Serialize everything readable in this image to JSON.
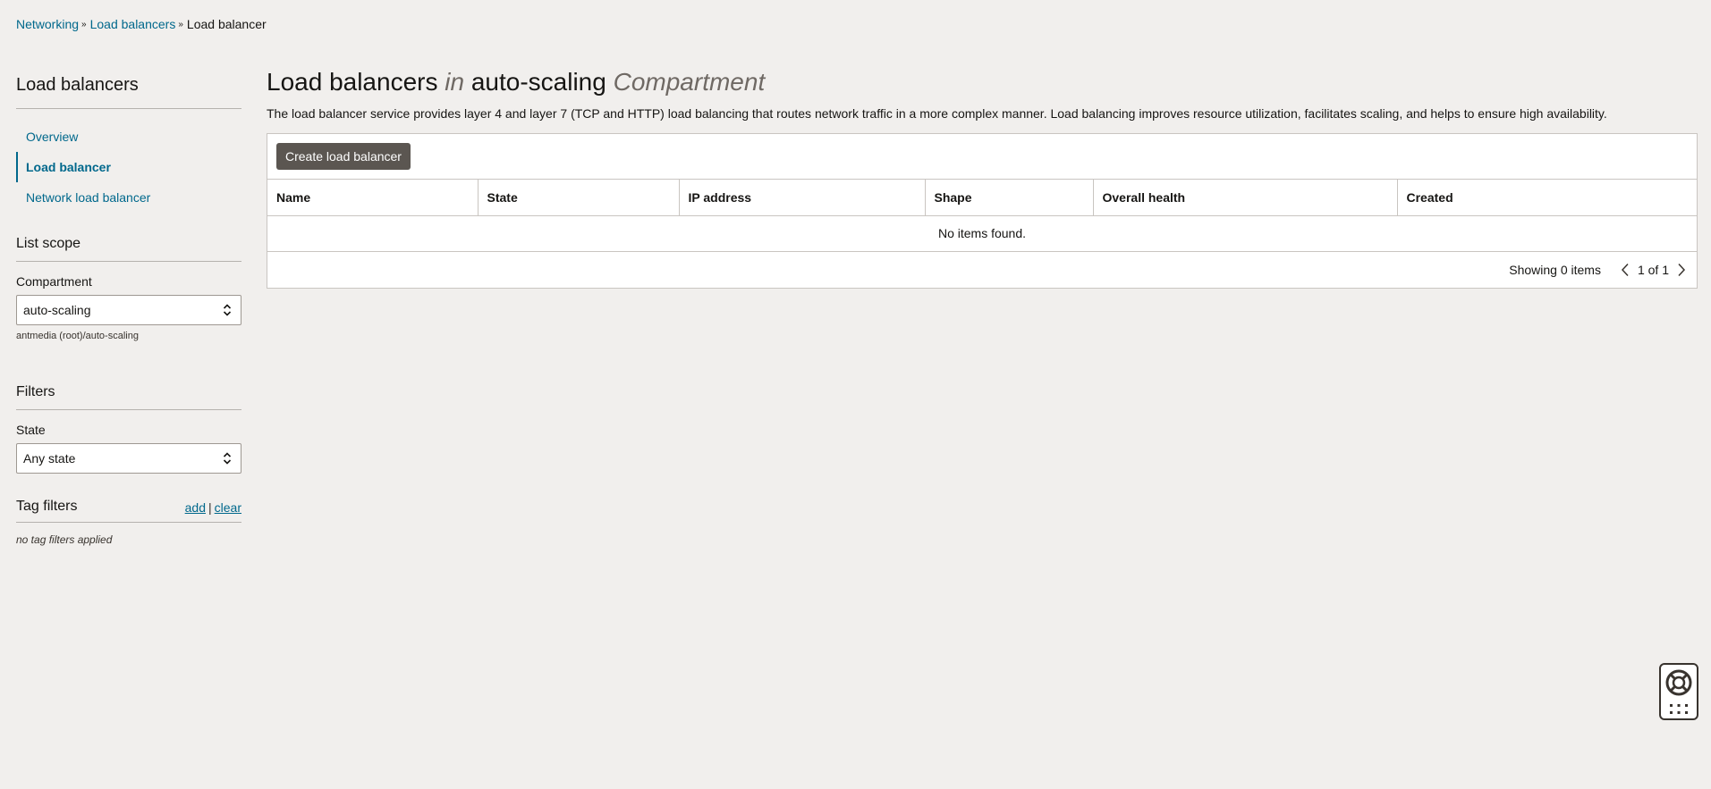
{
  "breadcrumb": {
    "items": [
      "Networking",
      "Load balancers"
    ],
    "current": "Load balancer"
  },
  "sidebar": {
    "title": "Load balancers",
    "nav": [
      {
        "label": "Overview",
        "active": false
      },
      {
        "label": "Load balancer",
        "active": true
      },
      {
        "label": "Network load balancer",
        "active": false
      }
    ],
    "list_scope": {
      "title": "List scope",
      "compartment_label": "Compartment",
      "compartment_value": "auto-scaling",
      "compartment_path": "antmedia (root)/auto-scaling"
    },
    "filters": {
      "title": "Filters",
      "state_label": "State",
      "state_value": "Any state"
    },
    "tag_filters": {
      "title": "Tag filters",
      "add_label": "add",
      "separator": "|",
      "clear_label": "clear",
      "empty_text": "no tag filters applied"
    }
  },
  "main": {
    "title_main": "Load balancers",
    "title_in": "in",
    "title_compartment": "auto-scaling",
    "title_suffix": "Compartment",
    "description": "The load balancer service provides layer 4 and layer 7 (TCP and HTTP) load balancing that routes network traffic in a more complex manner. Load balancing improves resource utilization, facilitates scaling, and helps to ensure high availability.",
    "create_button": "Create load balancer",
    "table": {
      "columns": [
        "Name",
        "State",
        "IP address",
        "Shape",
        "Overall health",
        "Created"
      ],
      "empty_text": "No items found."
    },
    "footer": {
      "showing": "Showing 0 items",
      "page": "1 of 1"
    }
  },
  "colors": {
    "link": "#00688c",
    "button_bg": "#5b5651",
    "page_bg": "#f1efed"
  }
}
